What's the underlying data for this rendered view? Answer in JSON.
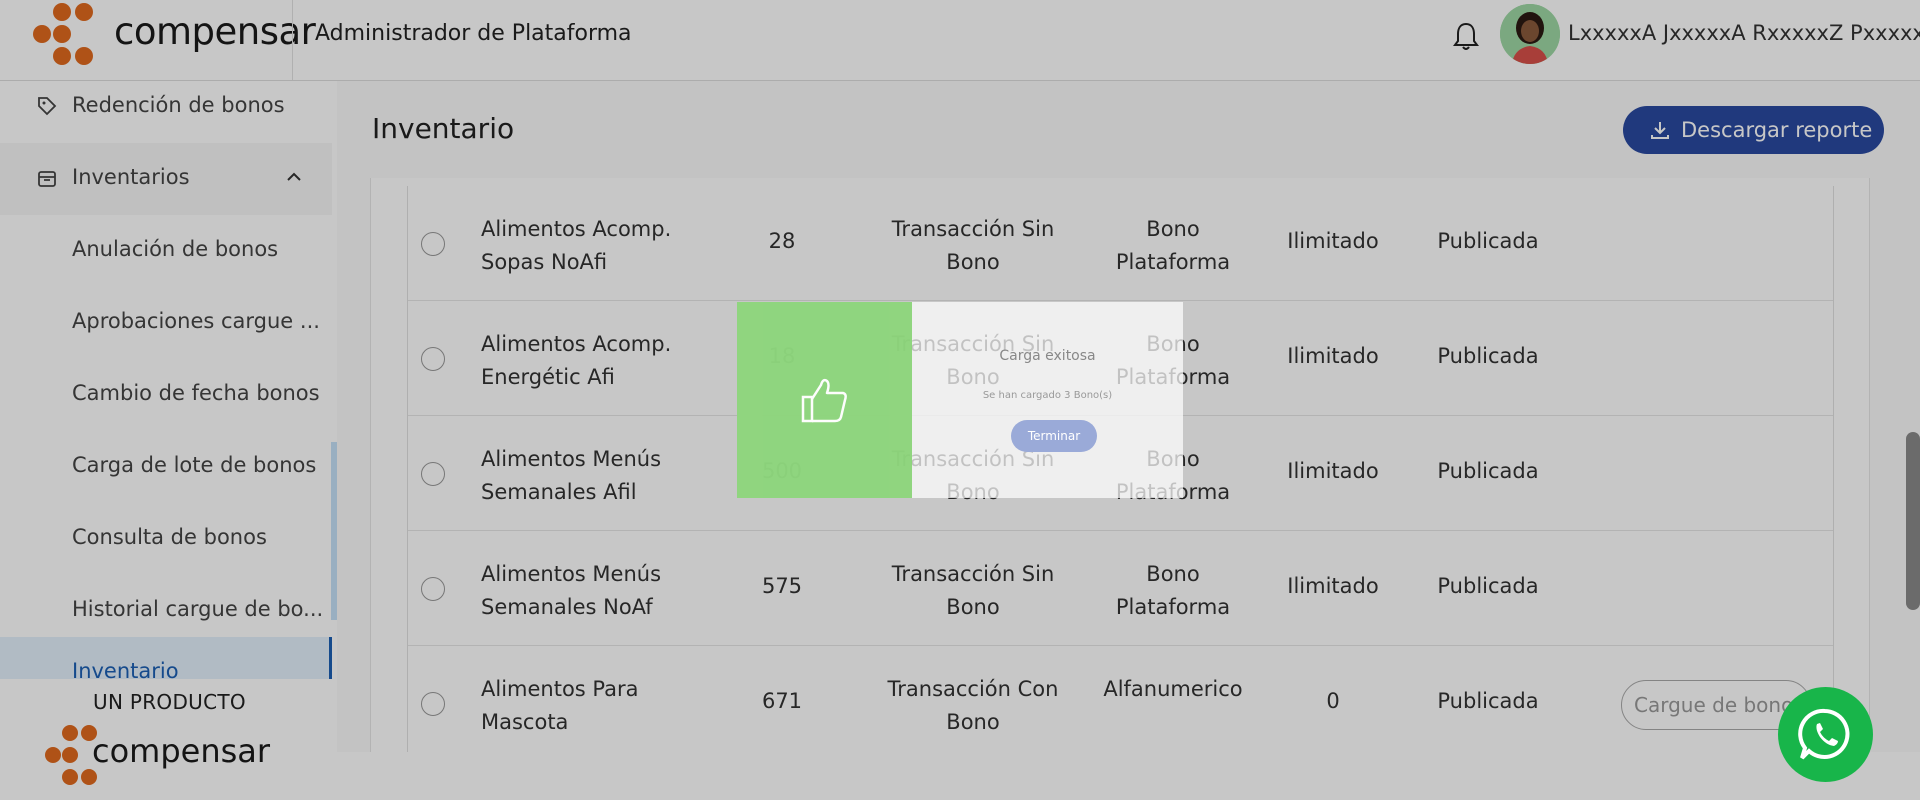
{
  "header": {
    "logo_text": "compensar",
    "app_title": "Administrador de Plataforma",
    "user_name": "LxxxxxA JxxxxxA RxxxxxZ PxxxxxA"
  },
  "sidebar": {
    "items": [
      {
        "label": "Redención de bonos"
      },
      {
        "label": "Inventarios"
      },
      {
        "label": "Anulación de bonos"
      },
      {
        "label": "Aprobaciones cargue ..."
      },
      {
        "label": "Cambio de fecha bonos"
      },
      {
        "label": "Carga de lote de bonos"
      },
      {
        "label": "Consulta de bonos"
      },
      {
        "label": "Historial cargue de bo..."
      },
      {
        "label": "Inventario"
      }
    ],
    "product_label": "UN PRODUCTO",
    "bottom_logo_text": "compensar"
  },
  "main": {
    "page_title": "Inventario",
    "download_button": "Descargar reporte",
    "rows": [
      {
        "name": "Alimentos Acomp. Sopas NoAfi",
        "qty": "28",
        "type": "Transacción Sin Bono",
        "category": "Bono Plataforma",
        "limit": "Ilimitado",
        "status": "Publicada",
        "action": ""
      },
      {
        "name": "Alimentos Acomp. Energétic Afi",
        "qty": "18",
        "type": "Transacción Sin Bono",
        "category": "Bono Plataforma",
        "limit": "Ilimitado",
        "status": "Publicada",
        "action": ""
      },
      {
        "name": "Alimentos Menús Semanales Afil",
        "qty": "500",
        "type": "Transacción Sin Bono",
        "category": "Bono Plataforma",
        "limit": "Ilimitado",
        "status": "Publicada",
        "action": ""
      },
      {
        "name": "Alimentos Menús Semanales NoAf",
        "qty": "575",
        "type": "Transacción Sin Bono",
        "category": "Bono Plataforma",
        "limit": "Ilimitado",
        "status": "Publicada",
        "action": ""
      },
      {
        "name": "Alimentos Para Mascota",
        "qty": "671",
        "type": "Transacción Con Bono",
        "category": "Alfanumerico",
        "limit": "0",
        "status": "Publicada",
        "action": "Cargue de bonos"
      }
    ]
  },
  "modal": {
    "title": "Carga exitosa",
    "subtitle": "Se han cargado 3 Bono(s)",
    "button": "Terminar"
  },
  "colors": {
    "primary": "#2a4aa0",
    "success": "#8ed67d",
    "brand_orange": "#e06a1e",
    "whatsapp": "#18b54a"
  }
}
